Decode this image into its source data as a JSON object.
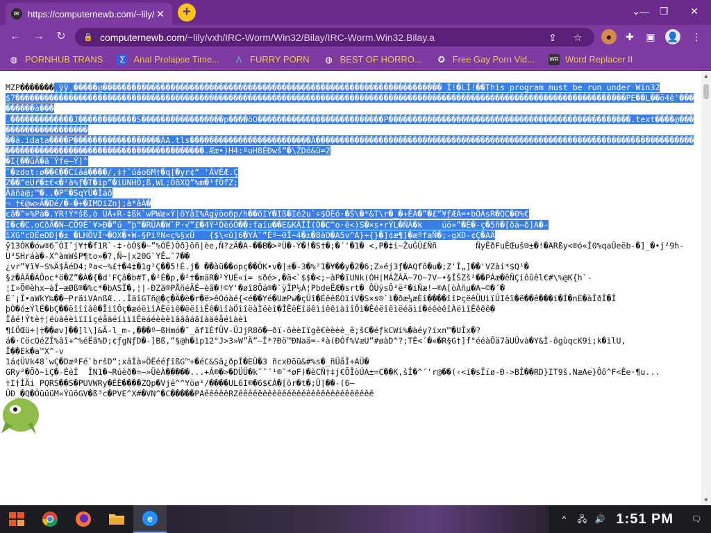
{
  "tab": {
    "title": "https://computernewb.com/~lily/",
    "close": "✕"
  },
  "new_tab": "+",
  "window": {
    "minimize": "—",
    "restore": "❐",
    "close": "✕"
  },
  "omnibox": {
    "domain": "computernewb.com",
    "path": "/~lily/vxh/IRC-Worm/Win32/Bilay/IRC-Worm.Win32.Bilay.a"
  },
  "bookmarks": [
    {
      "label": "PORNHUB TRANS",
      "icon": "globe-icon"
    },
    {
      "label": "Anal Prolapse Time...",
      "icon": "bookmark-icon"
    },
    {
      "label": "FURRY PORN",
      "icon": "lambda-icon"
    },
    {
      "label": "BEST OF HORRO...",
      "icon": "globe-icon"
    },
    {
      "label": "Free Gay Porn Vid...",
      "icon": "badge-icon"
    },
    {
      "label": "Word Replacer II",
      "icon": "wr-icon"
    }
  ],
  "content": {
    "line1": "MZP�������",
    "sel1": "¸ÿÿ¸�����@���������������������������������������������������������������������� Í!�LÍ!��This program must be run under Win32\n$7������������������������������������������������������������������������������������������������������������������������������PE��L��ö4ê'���������à���\n.�������������J������������S�����������������p����öO��������������������������P��������������������������������������������������.text����@��������������������\n��à.idata����P������������������ÀA.tls�������������������������À�����������������������������������������������������������������������������������������������������������������������.Ææ•)H4:ºuH8ÉÐwš“�\\ŽDó&ü=2\n�I{��ûÄ�â¯Ýfe—Ý]^\n˜�zdot:ø��€��Cíáá����/,‡†˜úáo6M†�q[�yr¢“ 'ÀVÈÆ.Ç\nZ��^eUŕ�‡€<�²à%ƒ�T�ip”�iUNHÖ;ß,WL;ÕõXQ”%m�¹fÕfZ;\nÂãñà@;™�..�P”�SqYÜ�Îáð\n¬ †€@w>Ä�Dé/�-�+�IMDiZnj;à*âÀ�\ncã�^»%Pà�.YR!Ý*šß,ò ÚÄ+R-‡ßk`wPWæ«Ý|õYåI%Ãgÿòo6p/h��õIÝ�Iß�Ié2u`÷$ÕÈó·�Š\\�*&T\\r�_�+ÊÄ�”�£“¥ƒÆÄ=•bÖÁsR�QC�0%€\nI�c�C.oCðÄ�N—CÕ9È`¥>Ð�”ú_”þ“�RÛA�W`P·√”£�4Ý³ÖèóÖ��:faíu��E&KÁÎÎ(Ò�C^o·ê<)S�×s•rÝL�ÑÂ�k    úö»”�É�-ç�5ñ�[ðá~ð]A�-\nìXG“cDÉeDÐ|�± �LHÖVÏ¬�OX�•W-§PiºN<ç%§xÜ   {$\\<û]6�YÀ¨”Éº—0Î~4�±�8àO�A5v^A}+{}�]¢æ¶]�æºfaÑ�;-gXD-¢Ç�AÄ",
    "rest": "\nÿ13ÓK�ów®6˜ÓIˆj¥†�f1R`-‡·òÓ§�~”%ÓÉ)Òð}öñ|èe,Ñ?zÄ�A-��B�>ªÜ�-Ý�!�S†�;�´'�1� <,P�‡i~ŽuĜÛ£Ññ        ÑyÊðFuÊŒuš®±�!�ARßy<®ó«Î0%qaÛeëb-�]_�•j²9h-\nÚ³SHráà�-X^àmWšP¶to»�?,Ñ~|x20G`YÊ…˜7��\n¿vr”¥ï¥~S%Ä$ÂéD4;ªa<~%£†�4‡�1g²Ç��5!É.j� ��àü��opç��ÕK•v�|±�-3�%²1�¥��y�2�6;Z»éj3ƒ�AQfô�u�;Z'Î„]��'VZài*$Q¹�\n§z�ÁÃ�ÀÖoc*ö�Z”�À�{�d'FÇâ�b#T,�²É�p,�²†�mäR�²ÝUÉ«í= sðé>,�ä<`$$�<;~àP�ïUNk(ÒH|MÁŽÂÄ~7O~7V—•§ÎŠZš²��PÁæ�êÑÇiôûêl€#\\%@K{h`-\n¦I»Õ®èhx–àÍ–æØß®�%c*�bASÏ�,¦|-ÐZã®PÅñéÄÉ—èâ�!©Y'�øî8Öä®�`ÿÎP½À­¦PbdeËÆ�srt� ÔÙÿsÔ³ë²�iÑæ!—®A[òÀñµ�A~©�´�\nÉ¨¡Î•aWkY‰��—PräìVAnßÆ...ÎäîGTñ@�ç�Ä�è�r�ë>êÒóàé{<é��Yé�UæPw�çÛî�ÉêêßÓïíV�S×s®`ì�ðæ¼æÈî����îîÞçëêÜUìïÛIêï�ë��ê���i�Í�nÈ�àÎðÎ�Î\nþÒ�ó±ÝlÉ�bÇ��ëîîîâê�ÎìîÔç�æéëìîÀÈëìê�ëëîìÊê�ìîàÖîîëàÌëèî�ÎÊëÈîäêìíêêìàîîÔì�Êéëîêìëéäìí�éêèêîÀëìîÊêêê�\nÎâé!Ýtè†¦ëùàêèìïîîçéåäéíììîÊëáéèèèìâââáãîàäêåéìàèì\n¶îÖŒü÷|†��øv]��]l\\]&Ä-l_m-,���º–ßHmó�˜_ãf1ÉfÜV-ÜJjR8õ�—ðï-õèèIïgê€èèèè_ê;šC�éƒkCWi%�àéy?íxn™�UÎx�?\ná�·CöcQéZÎ%âî+^%éËã%D;¢ƒgNƒD�-]Bß,“§@h�ìp12°J>3»W”Ä”—Î*?Ðö™ÐNaä=-ªà(ÐÓf%VæU”#øàD^?;TÉ<´�«�R§G†]f°ééàÕä7äUÜvà�Y&Ì-ôgùqcK9i;k�ilU,\nÎ��Ek�a™X^-v\n1á¢ÜVk48`wÇ�DæªFé`bršD“;xâÎà»ÖËééƒîßG™+�éC&Sâ¿ðpÎ�EÜ�3 ñcxÐöü&#%s�_ñÜåÎ+AÜ�\nGRy²�Õð~ìÇ�-ÉéÍ  ÎN1�~Rúèð�=—»ÜèÀ�����...+Á®�>�DÜÜ�k˜ˆ´¹®˜*øF)�èCÑ†‡j€ÕÎòÚA±=C��K,šÎ�^´'r@��(‹<í�sÏïø-Đ->BÎ��RD}IT9š.NæAe}Ôô^F<Êe·¶u...\n†I†ÍÄi PQRS��S�PUVWRy�ÉÈ����ZQp�Vjé^^Yöø¹/����UL6I®�6$€Á�[õr�t�;Ü|��-(6—\nÜÐ_�Q�ÕüüüM«ÝüöGV�ß³c�PVE^X#�VN^�C�����PAêêêêêRZêêêêêêêêêêêêêêêêêêêêêêêêêêêê"
  },
  "taskbar": {
    "clock": "1:51 PM",
    "apps": [
      "chrome-icon",
      "firefox-icon",
      "folder-icon",
      "edge-icon"
    ]
  },
  "colors": {
    "accent": "#7d3aa0",
    "selection": "#3a7ee8",
    "bookmark_text": "#f0c84a"
  }
}
